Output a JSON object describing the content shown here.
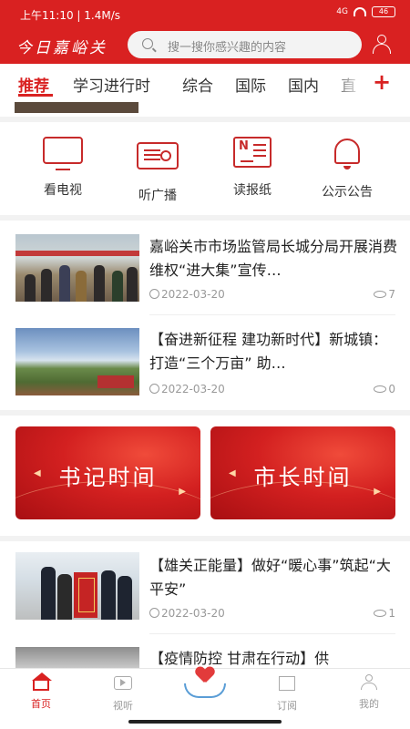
{
  "statusbar": {
    "left": "上午11:10 | 1.4M/s",
    "signal": "4G",
    "battery": "46"
  },
  "header": {
    "logo": "今日嘉峪关",
    "search_placeholder": "搜一搜你感兴趣的内容"
  },
  "tabs": [
    "推荐",
    "学习进行时",
    "综合",
    "国际",
    "国内",
    "直"
  ],
  "tab_add": "+",
  "quick_links": [
    "看电视",
    "听广播",
    "读报纸",
    "公示公告"
  ],
  "news": [
    {
      "title": "嘉峪关市市场监管局长城分局开展消费维权“进大集”宣传…",
      "date": "2022-03-20",
      "views": "7"
    },
    {
      "title": "【奋进新征程 建功新时代】新城镇：打造“三个万亩” 助…",
      "date": "2022-03-20",
      "views": "0"
    },
    {
      "title": "【雄关正能量】做好“暖心事”筑起“大平安”",
      "date": "2022-03-20",
      "views": "1"
    },
    {
      "title": "【疫情防控 甘肃在行动】供",
      "date": "",
      "views": ""
    }
  ],
  "banners": [
    "书记时间",
    "市长时间"
  ],
  "bottom_nav": [
    "首页",
    "视听",
    "订阅",
    "我的"
  ]
}
